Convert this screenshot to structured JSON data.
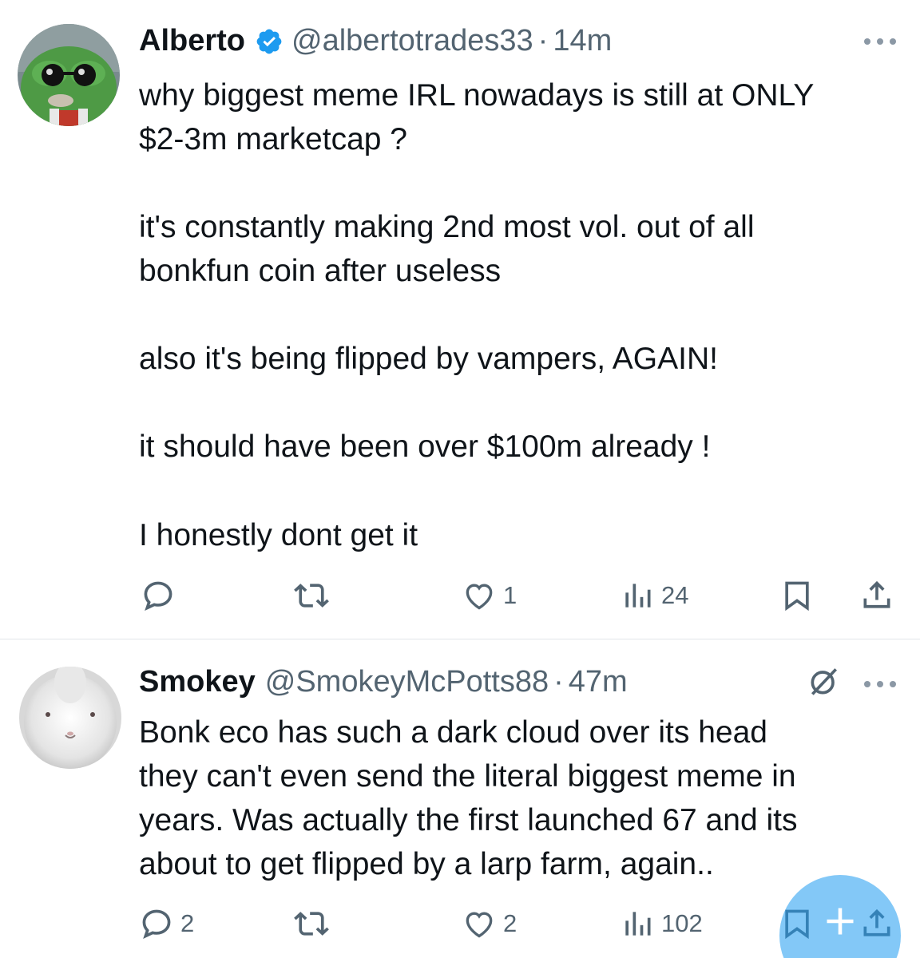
{
  "posts": [
    {
      "author": {
        "name": "Alberto",
        "handle": "@albertotrades33",
        "time": "14m",
        "verified": true,
        "avatar": "pepe-sunglasses-avatar"
      },
      "paragraphs": [
        [
          "why biggest meme IRL nowadays is still at ONLY",
          "$2-3m marketcap ?"
        ],
        [
          "it's constantly making 2nd most vol. out of all",
          "bonkfun coin after useless"
        ],
        [
          "also it's being flipped by vampers, AGAIN!"
        ],
        [
          "it should have been over $100m already !"
        ],
        [
          "I honestly dont get it"
        ]
      ],
      "actions": {
        "replies": "",
        "reposts": "",
        "likes": "1",
        "views": "24"
      }
    },
    {
      "author": {
        "name": "Smokey",
        "handle": "@SmokeyMcPotts88",
        "time": "47m",
        "verified": false,
        "avatar": "white-rabbit-avatar"
      },
      "lines": [
        "Bonk eco has such a dark cloud over its head",
        "they can't even send the literal biggest meme in",
        "years. Was actually the first launched 67 and its",
        "about to get flipped by a larp farm, again.."
      ],
      "actions": {
        "replies": "2",
        "reposts": "",
        "likes": "2",
        "views": "102"
      }
    }
  ],
  "separator": "·",
  "icons": [
    "reply-icon",
    "repost-icon",
    "like-icon",
    "views-icon",
    "bookmark-icon",
    "share-icon",
    "more-icon",
    "grok-icon",
    "verified-badge-icon",
    "compose-icon"
  ],
  "colors": {
    "text": "#0f1419",
    "secondary": "#536471",
    "verified": "#1d9bf0",
    "compose_fab": "#1d9bf0"
  }
}
